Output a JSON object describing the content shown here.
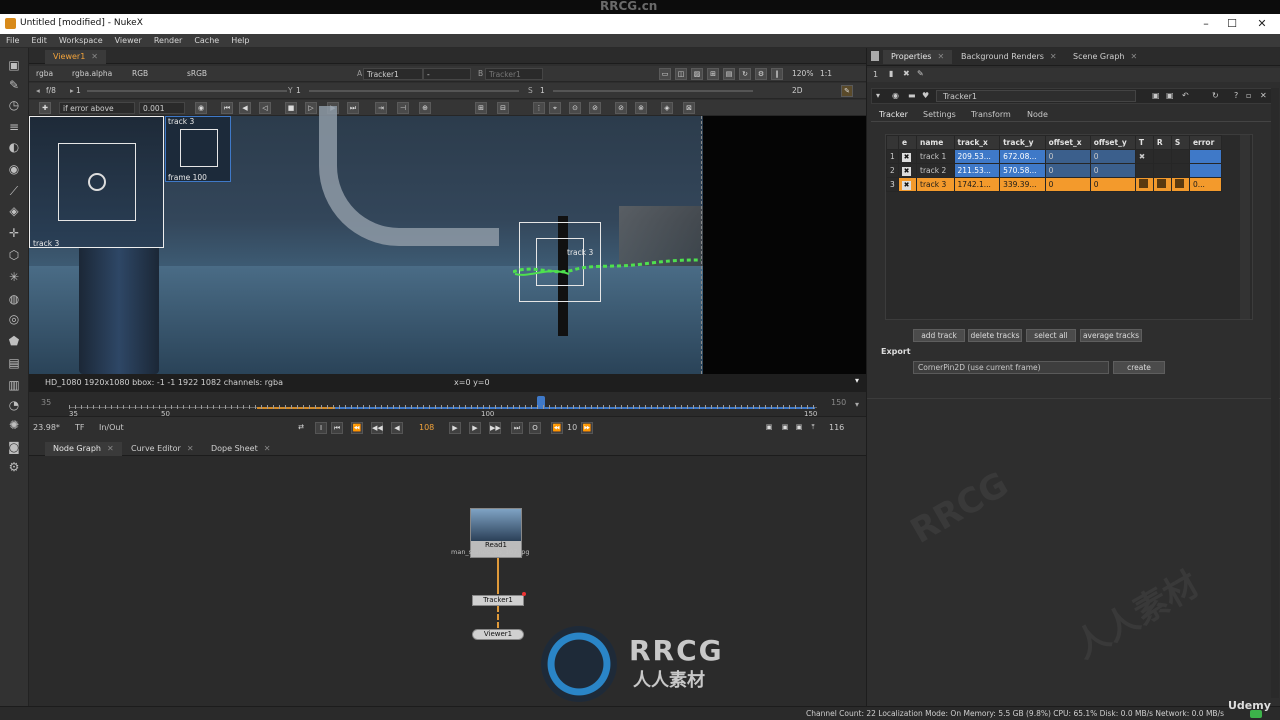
{
  "watermark_top": "RRCG.cn",
  "window": {
    "title": "Untitled [modified] - NukeX",
    "min": "–",
    "max": "☐",
    "close": "✕"
  },
  "menu": [
    "File",
    "Edit",
    "Workspace",
    "Viewer",
    "Render",
    "Cache",
    "Help"
  ],
  "viewer": {
    "tab": "Viewer1",
    "channels": "rgba",
    "alpha": "rgba.alpha",
    "rgb": "RGB",
    "colorspace": "sRGB",
    "input_a": "Tracker1",
    "input_a_extra": "-",
    "input_b": "Tracker1",
    "zoom": "120%",
    "ratio": "1:1",
    "fstop": "f/8",
    "frame_field": "1",
    "y_label": "Y",
    "y_value": "1",
    "s_label": "S",
    "s_value": "1",
    "a_label": "A",
    "b_label": "B",
    "mode": "2D",
    "error_mode": "if error above",
    "error_value": "0.001",
    "info": "HD_1080 1920x1080  bbox: -1 -1 1922 1082 channels: rgba",
    "coords": "x=0 y=0",
    "overlay_labels": {
      "top_small": "track 3",
      "frame": "frame 100",
      "left_zoom": "track 3",
      "center": "track 3"
    }
  },
  "timeline": {
    "start": "35",
    "end": "150",
    "marks": [
      "35",
      "50",
      "100",
      "150"
    ],
    "fps": "23.98*",
    "tf": "TF",
    "range_mode": "In/Out",
    "current_frame": "108",
    "increment": "10",
    "end_frame": "116"
  },
  "bottom_tabs": [
    "Node Graph",
    "Curve Editor",
    "Dope Sheet"
  ],
  "nodes": {
    "read": "Read1",
    "read_file": "man_stands_up_107.jpg",
    "tracker": "Tracker1",
    "viewer": "Viewer1"
  },
  "properties": {
    "tabs": [
      "Properties",
      "Background Renders",
      "Scene Graph"
    ],
    "count": "1",
    "node_name": "Tracker1",
    "subtabs": [
      "Tracker",
      "Settings",
      "Transform",
      "Node"
    ],
    "columns": [
      "e",
      "name",
      "track_x",
      "track_y",
      "offset_x",
      "offset_y",
      "T",
      "R",
      "S",
      "error"
    ],
    "rows": [
      {
        "idx": "1",
        "name": "track 1",
        "track_x": "209.53...",
        "track_y": "672.08...",
        "offset_x": "0",
        "offset_y": "0",
        "error": ""
      },
      {
        "idx": "2",
        "name": "track 2",
        "track_x": "211.53...",
        "track_y": "570.58...",
        "offset_x": "0",
        "offset_y": "0",
        "error": ""
      },
      {
        "idx": "3",
        "name": "track 3",
        "track_x": "1742.1...",
        "track_y": "339.39...",
        "offset_x": "0",
        "offset_y": "0",
        "error": "0..."
      }
    ],
    "buttons": [
      "add track",
      "delete tracks",
      "select all",
      "average tracks"
    ],
    "export_label": "Export",
    "export_value": "CornerPin2D (use current frame)",
    "create": "create"
  },
  "status": "Channel Count: 22  Localization Mode: On  Memory: 5.5 GB (9.8%)  CPU: 65.1%  Disk: 0.0 MB/s  Network: 0.0 MB/s",
  "logo": {
    "rrcg": "RRCG",
    "cn": "人人素材"
  },
  "udemy": "Udemy",
  "colors": {
    "accent": "#f2a33b",
    "selected_row": "#f39a2c",
    "blue_cell": "#3f79c8",
    "track_green": "#4ee04e"
  }
}
